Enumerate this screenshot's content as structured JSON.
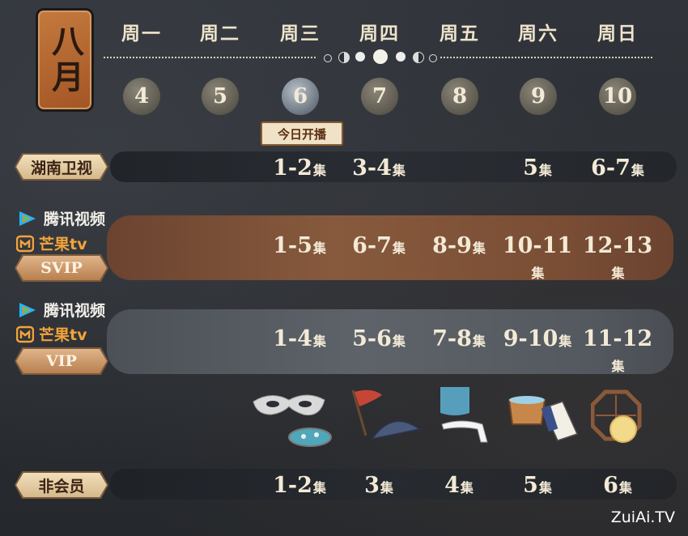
{
  "month": "八月",
  "weekdays": [
    "周一",
    "周二",
    "周三",
    "周四",
    "周五",
    "周六",
    "周日"
  ],
  "dates": [
    "4",
    "5",
    "6",
    "7",
    "8",
    "9",
    "10"
  ],
  "today_tag": "今日开播",
  "rows": {
    "tv": {
      "label": "湖南卫视",
      "cells": [
        "",
        "",
        "1-2",
        "3-4",
        "",
        "5",
        "6-7"
      ]
    },
    "svip": {
      "platform1": "腾讯视频",
      "platform2": "芒果tv",
      "label": "SVIP",
      "cells": [
        "",
        "",
        "1-5",
        "6-7",
        "8-9",
        "10-11",
        "12-13"
      ]
    },
    "vip": {
      "platform1": "腾讯视频",
      "platform2": "芒果tv",
      "label": "VIP",
      "cells": [
        "",
        "",
        "1-4",
        "5-6",
        "7-8",
        "9-10",
        "11-12"
      ]
    },
    "free": {
      "label": "非会员",
      "cells": [
        "",
        "",
        "1-2",
        "3",
        "4",
        "5",
        "6"
      ]
    }
  },
  "episode_unit": "集",
  "watermark": "ZuiAi.TV",
  "colors": {
    "background": "#2b2f35",
    "svip_band": "#875a3d",
    "vip_band": "#5e636a",
    "seal": "#b0612c",
    "text": "#f3ead6"
  },
  "icons": [
    "mask-icon",
    "pond-icon",
    "flag-icon",
    "fan-icon",
    "veil-icon",
    "blindfold-icon",
    "tub-icon",
    "book-icon",
    "window-icon",
    "moon-icon"
  ]
}
